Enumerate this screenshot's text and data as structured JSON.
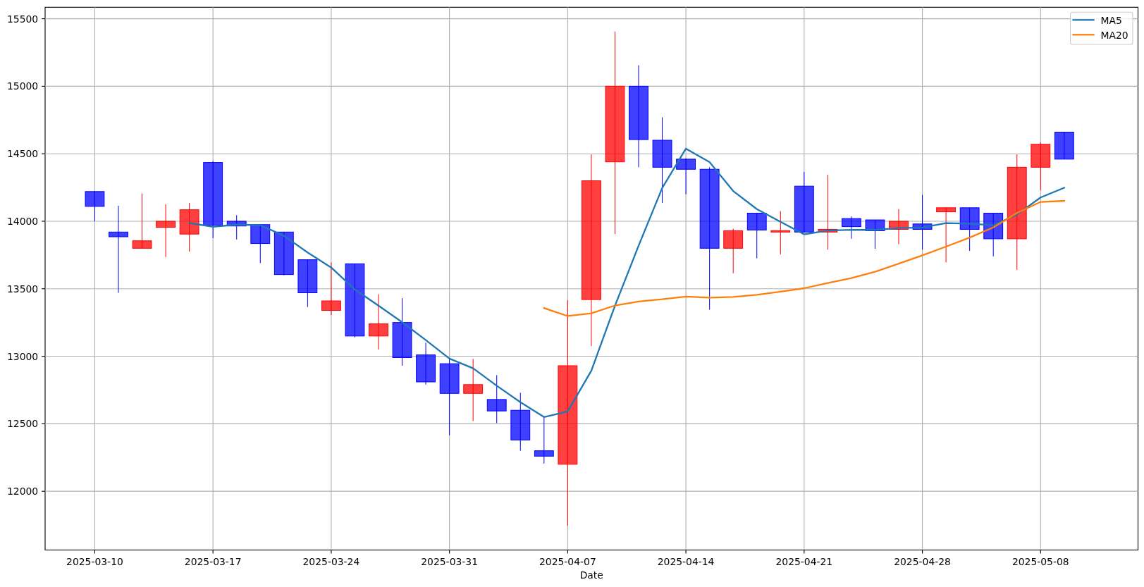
{
  "plot": {
    "chart_data": {
      "type": "line",
      "xlabel": "Date",
      "grid": true,
      "legend": "upper right",
      "categories": [
        "2025-03-10",
        null,
        null,
        null,
        null,
        "2025-03-17",
        null,
        null,
        null,
        null,
        "2025-03-24",
        null,
        null,
        null,
        null,
        "2025-03-31",
        null,
        null,
        null,
        null,
        "2025-04-07",
        null,
        null,
        null,
        null,
        "2025-04-14",
        null,
        null,
        null,
        null,
        "2025-04-21",
        null,
        null,
        null,
        null,
        "2025-04-28",
        null,
        null,
        null,
        null,
        "2025-05-08",
        null
      ],
      "ylim": [
        11565,
        15585
      ],
      "yticks": [
        12000,
        12500,
        13000,
        13500,
        14000,
        14500,
        15000,
        15500
      ],
      "series": [
        {
          "type": "candlestick",
          "ohlc": [
            [
              14220,
              14220,
              14000,
              14110
            ],
            [
              13920,
              14115,
              13470,
              13885
            ],
            [
              13800,
              14205,
              13800,
              13855
            ],
            [
              13955,
              14125,
              13735,
              14000
            ],
            [
              13905,
              14135,
              13775,
              14085
            ],
            [
              14435,
              14445,
              13875,
              13970
            ],
            [
              14000,
              14045,
              13865,
              13965
            ],
            [
              13975,
              13975,
              13690,
              13835
            ],
            [
              13920,
              13920,
              13600,
              13605
            ],
            [
              13715,
              13715,
              13365,
              13470
            ],
            [
              13340,
              13695,
              13305,
              13410
            ],
            [
              13685,
              13685,
              13140,
              13150
            ],
            [
              13150,
              13460,
              13050,
              13240
            ],
            [
              13250,
              13430,
              12930,
              12990
            ],
            [
              13010,
              13100,
              12790,
              12810
            ],
            [
              12945,
              12985,
              12415,
              12725
            ],
            [
              12725,
              12980,
              12520,
              12790
            ],
            [
              12680,
              12860,
              12505,
              12595
            ],
            [
              12600,
              12730,
              12300,
              12380
            ],
            [
              12300,
              12555,
              12205,
              12260
            ],
            [
              12200,
              13415,
              11745,
              12930
            ],
            [
              13420,
              14495,
              13075,
              14300
            ],
            [
              14440,
              15405,
              13905,
              15000
            ],
            [
              15000,
              15155,
              14400,
              14605
            ],
            [
              14600,
              14770,
              14135,
              14400
            ],
            [
              14460,
              14465,
              14200,
              14385
            ],
            [
              14385,
              14400,
              13345,
              13800
            ],
            [
              13800,
              13945,
              13615,
              13930
            ],
            [
              14060,
              14060,
              13725,
              13935
            ],
            [
              13920,
              14075,
              13755,
              13930
            ],
            [
              14260,
              14365,
              13915,
              13920
            ],
            [
              13920,
              14345,
              13790,
              13940
            ],
            [
              14020,
              14035,
              13870,
              13960
            ],
            [
              14010,
              14010,
              13795,
              13930
            ],
            [
              13940,
              14090,
              13830,
              14000
            ],
            [
              13980,
              14195,
              13790,
              13940
            ],
            [
              14070,
              14100,
              13695,
              14100
            ],
            [
              14100,
              14100,
              13780,
              13940
            ],
            [
              14060,
              14060,
              13740,
              13870
            ],
            [
              13870,
              14495,
              13640,
              14400
            ],
            [
              14400,
              14585,
              14230,
              14570
            ],
            [
              14660,
              14660,
              14460,
              14460
            ]
          ]
        },
        {
          "name": "MA5",
          "color": "#1f77b4",
          "values": [
            null,
            null,
            null,
            null,
            13987,
            13959,
            13975,
            13971,
            13892,
            13769,
            13657,
            13494,
            13375,
            13252,
            13120,
            12983,
            12911,
            12782,
            12660,
            12550,
            12591,
            12893,
            13374,
            13819,
            14247,
            14538,
            14438,
            14224,
            14090,
            13996,
            13903,
            13931,
            13937,
            13936,
            13950,
            13954,
            13986,
            13982,
            13970,
            14050,
            14176,
            14248
          ]
        },
        {
          "name": "MA20",
          "color": "#ff7f0e",
          "values": [
            null,
            null,
            null,
            null,
            null,
            null,
            null,
            null,
            null,
            null,
            null,
            null,
            null,
            null,
            null,
            null,
            null,
            null,
            null,
            13357,
            13298,
            13318,
            13376,
            13406,
            13422,
            13442,
            13434,
            13439,
            13455,
            13478,
            13504,
            13543,
            13579,
            13626,
            13686,
            13747,
            13812,
            13879,
            13954,
            14061,
            14143,
            14151
          ]
        }
      ]
    }
  }
}
